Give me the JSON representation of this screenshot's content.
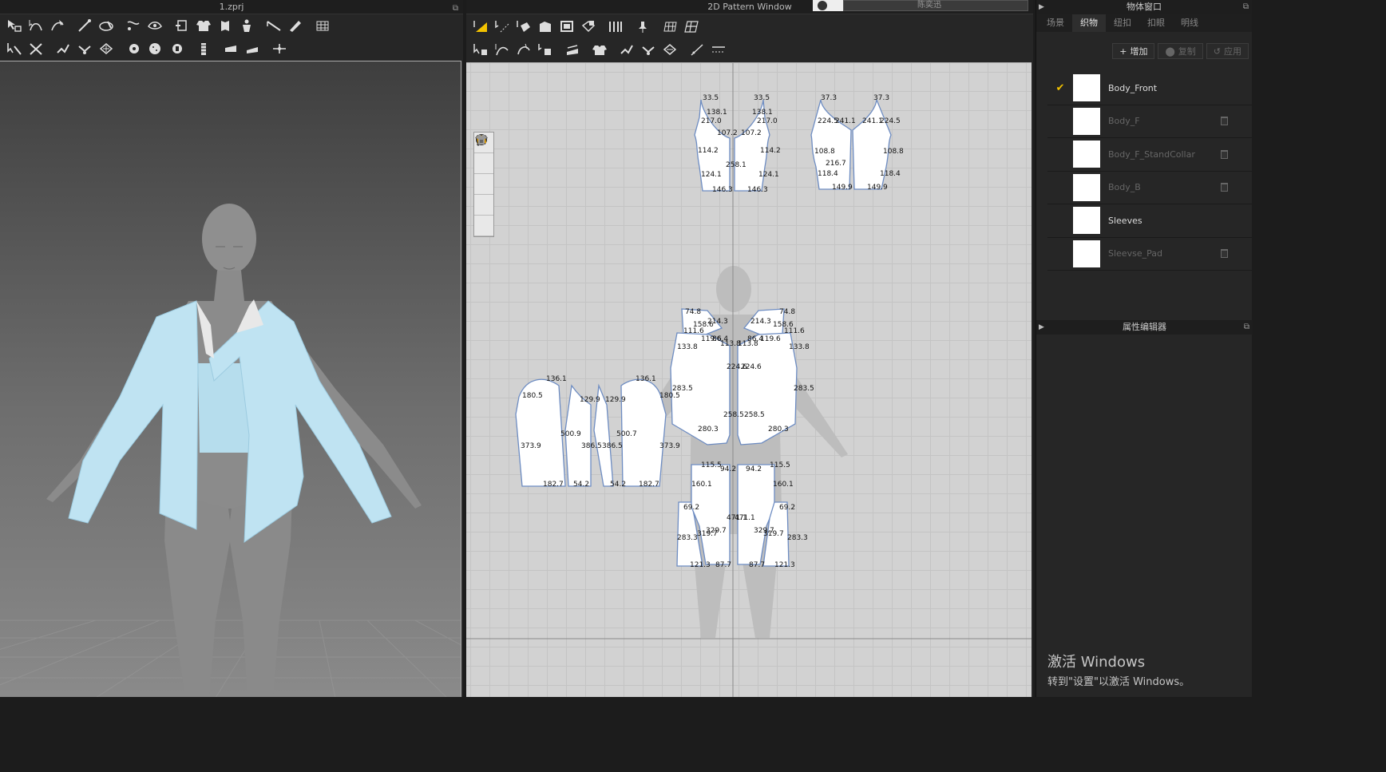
{
  "window3d": {
    "title": "1.zprj"
  },
  "window2d": {
    "title": "2D Pattern Window",
    "user_name": "陈奕迅"
  },
  "object_panel": {
    "title": "物体窗口",
    "tabs": [
      "场景",
      "织物",
      "纽扣",
      "扣眼",
      "明线"
    ],
    "active_tab": "织物",
    "actions": {
      "add": "增加",
      "copy": "复制",
      "apply": "应用"
    },
    "fabrics": [
      {
        "name": "Body_Front",
        "selected": true,
        "enabled": true,
        "deletable": false
      },
      {
        "name": "Body_F",
        "selected": false,
        "enabled": false,
        "deletable": true
      },
      {
        "name": "Body_F_StandCollar",
        "selected": false,
        "enabled": false,
        "deletable": true
      },
      {
        "name": "Body_B",
        "selected": false,
        "enabled": false,
        "deletable": true
      },
      {
        "name": "Sleeves",
        "selected": false,
        "enabled": true,
        "deletable": false
      },
      {
        "name": "Sleevse_Pad",
        "selected": false,
        "enabled": false,
        "deletable": true
      }
    ]
  },
  "property_panel": {
    "title": "属性编辑器"
  },
  "watermark": {
    "line1": "激活 Windows",
    "line2": "转到\"设置\"以激活 Windows。"
  },
  "pattern_labels": {
    "front_top_left": [
      "33.5",
      "138.1",
      "217.0",
      "107.2",
      "114.2",
      "258.1",
      "124.1",
      "146.3"
    ],
    "front_top_right": [
      "33.5",
      "138.1",
      "217.0",
      "107.2",
      "114.2",
      "124.1",
      "146.3"
    ],
    "back_top_left": [
      "37.3",
      "224.5",
      "241.1",
      "108.8",
      "118.4",
      "149.9",
      "216.7"
    ],
    "back_top_right": [
      "37.3",
      "241.1",
      "224.5",
      "108.8",
      "118.4",
      "149.9"
    ],
    "jacket_front_left": [
      "74.8",
      "158.6",
      "214.3",
      "111.6",
      "119.6",
      "86.4",
      "113.8",
      "133.8",
      "224.6",
      "283.5",
      "258.5",
      "280.3"
    ],
    "jacket_front_right": [
      "74.8",
      "214.3",
      "158.6",
      "111.6",
      "86.4",
      "119.6",
      "113.8",
      "133.8",
      "224.6",
      "283.5",
      "258.5",
      "280.3"
    ],
    "sleeve_left": [
      "136.1",
      "180.5",
      "373.9",
      "182.7",
      "129.9",
      "500.9",
      "386.5",
      "54.2"
    ],
    "sleeve_right": [
      "136.1",
      "180.5",
      "373.9",
      "182.7",
      "129.9",
      "500.7",
      "386.5",
      "54.2"
    ],
    "back_left": [
      "115.5",
      "94.2",
      "160.1",
      "69.2",
      "283.3",
      "319.7",
      "329.7",
      "471.1",
      "121.3",
      "87.7"
    ],
    "back_right": [
      "115.5",
      "94.2",
      "160.1",
      "69.2",
      "283.3",
      "319.7",
      "329.7",
      "471.1",
      "121.3",
      "87.7"
    ]
  },
  "colors": {
    "accent": "#f2c200",
    "garment": "#bfe3f2",
    "pattern_fill": "#ffffff",
    "pattern_edge": "#6d8cc2"
  }
}
